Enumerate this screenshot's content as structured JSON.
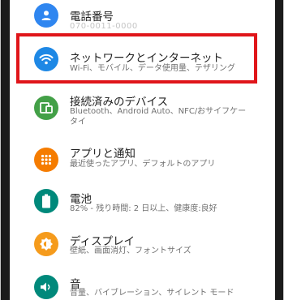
{
  "colors": {
    "highlight": "#e0151a",
    "user_icon": "#2f86f0",
    "network_icon": "#1e88e5",
    "devices_icon": "#43a047",
    "apps_icon": "#f57c00",
    "battery_icon": "#00897b",
    "display_icon": "#f59b1c",
    "sound_icon": "#00897b"
  },
  "settings": {
    "phone": {
      "title": "電話番号",
      "subtitle": "070-0011-0000",
      "icon": "person-icon"
    },
    "network": {
      "title": "ネットワークとインターネット",
      "subtitle": "Wi-Fi、モバイル、データ使用量、テザリング",
      "icon": "wifi-icon"
    },
    "devices": {
      "title": "接続済みのデバイス",
      "subtitle_line1": "Bluetooth、Android Auto、NFC/おサイフケー",
      "subtitle_line2": "タイ",
      "icon": "devices-icon"
    },
    "apps": {
      "title": "アプリと通知",
      "subtitle": "最近使ったアプリ、デフォルトのアプリ",
      "icon": "apps-grid-icon"
    },
    "battery": {
      "title": "電池",
      "subtitle": "82% - 残り時間: 2 日以上、健康度:良好",
      "icon": "battery-icon"
    },
    "display": {
      "title": "ディスプレイ",
      "subtitle": "壁紙、画面消灯、フォントサイズ",
      "icon": "brightness-icon"
    },
    "sound": {
      "title": "音",
      "subtitle": "音量、バイブレーション、サイレント モード",
      "icon": "speaker-icon"
    }
  }
}
